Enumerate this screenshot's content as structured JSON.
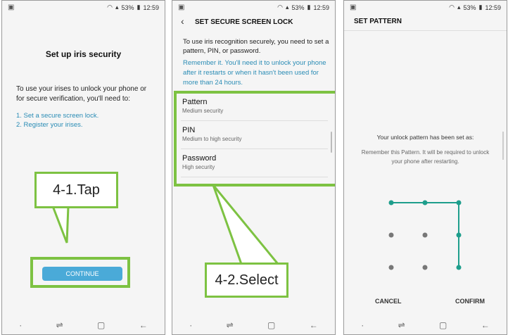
{
  "status": {
    "battery": "53%",
    "time": "12:59"
  },
  "screen1": {
    "title": "Set up iris security",
    "intro_line1": "To use your irises to unlock your phone or",
    "intro_line2": "for secure verification, you'll need to:",
    "step1": "1. Set a secure screen lock.",
    "step2": "2. Register your irises.",
    "continue_label": "CONTINUE",
    "callout": "4-1.Tap"
  },
  "screen2": {
    "title": "SET SECURE SCREEN LOCK",
    "desc_line1": "To use iris recognition securely, you need to set a",
    "desc_line2": "pattern, PIN, or password.",
    "note_line1": "Remember it. You'll need it to unlock your phone",
    "note_line2": "after it restarts or when it hasn't been used for",
    "note_line3": "more than 24 hours.",
    "options": [
      {
        "label": "Pattern",
        "sub": "Medium security"
      },
      {
        "label": "PIN",
        "sub": "Medium to high security"
      },
      {
        "label": "Password",
        "sub": "High security"
      }
    ],
    "callout": "4-2.Select"
  },
  "screen3": {
    "title": "SET PATTERN",
    "msg1": "Your unlock pattern has been set as:",
    "msg2_line1": "Remember this Pattern. It will be required to unlock",
    "msg2_line2": "your phone after restarting.",
    "cancel": "CANCEL",
    "confirm": "CONFIRM"
  },
  "colors": {
    "accent": "#7dc242",
    "teal": "#2a8cb5",
    "button": "#4aaad8",
    "pattern": "#1e9e8c"
  }
}
